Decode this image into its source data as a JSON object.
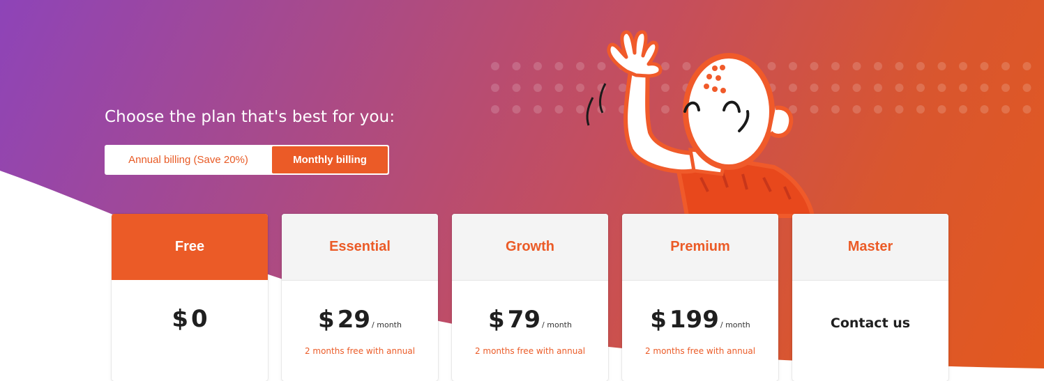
{
  "headline": "Choose the plan that's best for you:",
  "billing": {
    "annual_label": "Annual billing (Save 20%)",
    "monthly_label": "Monthly billing",
    "selected": "Monthly billing"
  },
  "colors": {
    "accent": "#eb5b27",
    "gradient_start": "#8e44b8",
    "gradient_end": "#e3591f"
  },
  "plans": [
    {
      "name": "Free",
      "currency": "$",
      "amount": "0",
      "period": "",
      "promo": "",
      "featured": true
    },
    {
      "name": "Essential",
      "currency": "$",
      "amount": "29",
      "period": "/ month",
      "promo": "2 months free with annual"
    },
    {
      "name": "Growth",
      "currency": "$",
      "amount": "79",
      "period": "/ month",
      "promo": "2 months free with annual"
    },
    {
      "name": "Premium",
      "currency": "$",
      "amount": "199",
      "period": "/ month",
      "promo": "2 months free with annual"
    },
    {
      "name": "Master",
      "contact": "Contact us"
    }
  ],
  "icons": [
    "waving-mascot-illustration",
    "dot-pattern"
  ]
}
